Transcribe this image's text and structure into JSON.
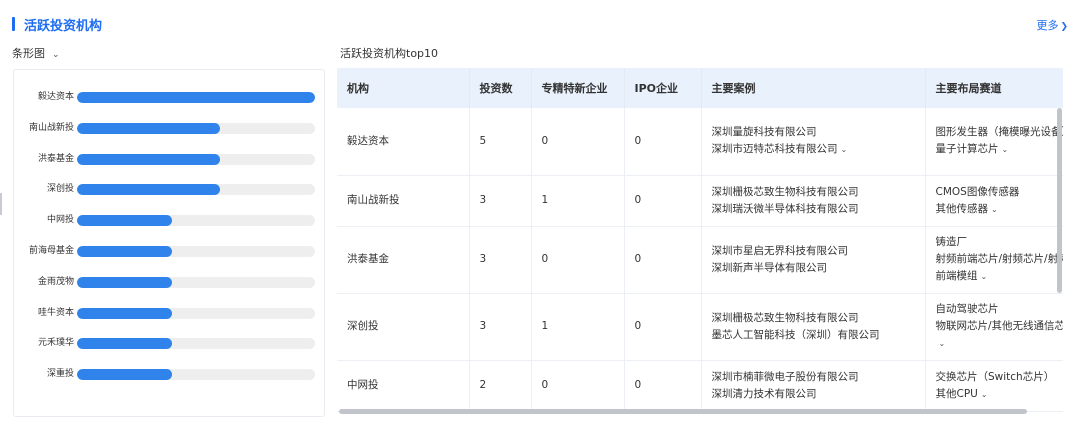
{
  "header": {
    "title": "活跃投资机构",
    "more_label": "更多"
  },
  "view_select": {
    "label": "条形图"
  },
  "table_caption": "活跃投资机构top10",
  "chart_data": {
    "type": "bar",
    "orientation": "horizontal",
    "categories": [
      "毅达资本",
      "南山战新投",
      "洪泰基金",
      "深创投",
      "中网投",
      "前海母基金",
      "金雨茂物",
      "哇牛资本",
      "元禾璞华",
      "深重投"
    ],
    "values": [
      5,
      3,
      3,
      3,
      2,
      2,
      2,
      2,
      2,
      2
    ],
    "xlim": [
      0,
      5
    ],
    "grid": false,
    "legend": "none",
    "bar_color": "#2f83ea",
    "track_color": "#eeeeee"
  },
  "table": {
    "columns": [
      "机构",
      "投资数",
      "专精特新企业",
      "IPO企业",
      "主要案例",
      "主要布局赛道"
    ],
    "rows": [
      {
        "org": "毅达资本",
        "investments": "5",
        "specialized": "0",
        "ipo": "0",
        "cases": [
          "深圳量旋科技有限公司",
          "深圳市迈特芯科技有限公司"
        ],
        "tracks": [
          "图形发生器（掩模曝光设备）",
          "量子计算芯片"
        ]
      },
      {
        "org": "南山战新投",
        "investments": "3",
        "specialized": "1",
        "ipo": "0",
        "cases": [
          "深圳栅极芯致生物科技有限公司",
          "深圳瑞沃微半导体科技有限公司"
        ],
        "tracks": [
          "CMOS图像传感器",
          "其他传感器"
        ]
      },
      {
        "org": "洪泰基金",
        "investments": "3",
        "specialized": "0",
        "ipo": "0",
        "cases": [
          "深圳市星启无界科技有限公司",
          "深圳新声半导体有限公司"
        ],
        "tracks": [
          "铸造厂",
          "射频前端芯片/射频芯片/射频前端模组"
        ]
      },
      {
        "org": "深创投",
        "investments": "3",
        "specialized": "1",
        "ipo": "0",
        "cases": [
          "深圳栅极芯致生物科技有限公司",
          "墨芯人工智能科技（深圳）有限公司"
        ],
        "tracks": [
          "自动驾驶芯片",
          "物联网芯片/其他无线通信芯片"
        ]
      },
      {
        "org": "中网投",
        "investments": "2",
        "specialized": "0",
        "ipo": "0",
        "cases": [
          "深圳市楠菲微电子股份有限公司",
          "深圳清力技术有限公司"
        ],
        "tracks": [
          "交换芯片（Switch芯片）",
          "其他CPU"
        ]
      }
    ]
  }
}
